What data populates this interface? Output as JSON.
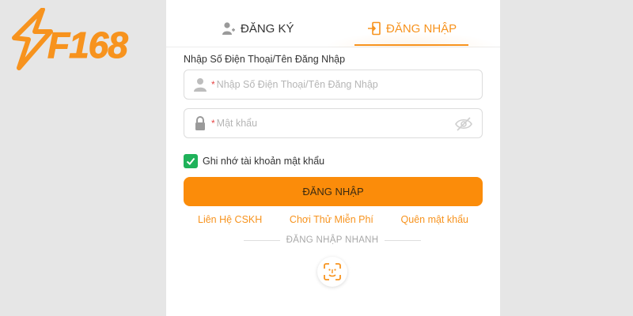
{
  "brand": {
    "logo_text": "F168",
    "logo_icon": "lightning-bolt-icon",
    "accent_color": "#f7931e"
  },
  "tabs": [
    {
      "label": "ĐĂNG KÝ",
      "icon": "user-add-icon",
      "active": false
    },
    {
      "label": "ĐĂNG NHẬP",
      "icon": "login-door-icon",
      "active": true
    }
  ],
  "form": {
    "username_label": "Nhập Số Điện Thoại/Tên Đăng Nhập",
    "username_placeholder": "Nhập Số Điện Thoại/Tên Đăng Nhập",
    "password_placeholder": "Mật khẩu",
    "required_mark": "*",
    "remember_label": "Ghi nhớ tài khoản mật khẩu",
    "remember_checked": true,
    "submit_label": "ĐĂNG NHẬP"
  },
  "links": [
    {
      "label": "Liên Hệ CSKH"
    },
    {
      "label": "Chơi Thử Miễn Phí"
    },
    {
      "label": "Quên mật khẩu"
    }
  ],
  "quick_login": {
    "label": "ĐĂNG NHẬP NHANH",
    "icon": "face-id-icon"
  },
  "colors": {
    "page_bg": "#e6e6e6",
    "button_bg": "#fb8c0a",
    "checkbox": "#1fb25a"
  }
}
